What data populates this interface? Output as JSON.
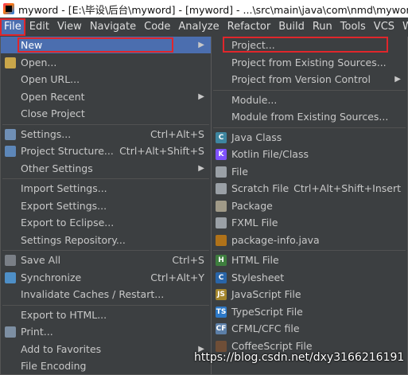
{
  "window": {
    "title": "myword - [E:\\毕设\\后台\\myword] - [myword] - ...\\src\\main\\java\\com\\nmd\\myword\\controller"
  },
  "menubar": [
    {
      "label": "File",
      "active": true
    },
    {
      "label": "Edit"
    },
    {
      "label": "View"
    },
    {
      "label": "Navigate"
    },
    {
      "label": "Code"
    },
    {
      "label": "Analyze"
    },
    {
      "label": "Refactor"
    },
    {
      "label": "Build"
    },
    {
      "label": "Run"
    },
    {
      "label": "Tools"
    },
    {
      "label": "VCS"
    },
    {
      "label": "Window"
    }
  ],
  "file_menu": [
    {
      "label": "New",
      "arrow": true,
      "selected": true
    },
    {
      "label": "Open...",
      "icon": "folder-icon"
    },
    {
      "label": "Open URL..."
    },
    {
      "label": "Open Recent",
      "arrow": true
    },
    {
      "label": "Close Project"
    },
    {
      "sep": true
    },
    {
      "label": "Settings...",
      "icon": "wrench-icon",
      "shortcut": "Ctrl+Alt+S"
    },
    {
      "label": "Project Structure...",
      "icon": "project-structure-icon",
      "shortcut": "Ctrl+Alt+Shift+S"
    },
    {
      "label": "Other Settings",
      "arrow": true
    },
    {
      "sep": true
    },
    {
      "label": "Import Settings..."
    },
    {
      "label": "Export Settings..."
    },
    {
      "label": "Export to Eclipse..."
    },
    {
      "label": "Settings Repository..."
    },
    {
      "sep": true
    },
    {
      "label": "Save All",
      "icon": "save-icon",
      "shortcut": "Ctrl+S"
    },
    {
      "label": "Synchronize",
      "icon": "sync-icon",
      "shortcut": "Ctrl+Alt+Y"
    },
    {
      "label": "Invalidate Caches / Restart..."
    },
    {
      "sep": true
    },
    {
      "label": "Export to HTML..."
    },
    {
      "label": "Print...",
      "icon": "print-icon"
    },
    {
      "label": "Add to Favorites",
      "arrow": true
    },
    {
      "label": "File Encoding"
    }
  ],
  "new_submenu": [
    {
      "label": "Project..."
    },
    {
      "label": "Project from Existing Sources..."
    },
    {
      "label": "Project from Version Control",
      "arrow": true
    },
    {
      "sep": true
    },
    {
      "label": "Module..."
    },
    {
      "label": "Module from Existing Sources..."
    },
    {
      "sep": true
    },
    {
      "label": "Java Class",
      "icon": "java-class-icon"
    },
    {
      "label": "Kotlin File/Class",
      "icon": "kotlin-icon"
    },
    {
      "label": "File",
      "icon": "file-icon"
    },
    {
      "label": "Scratch File",
      "icon": "scratch-file-icon",
      "shortcut": "Ctrl+Alt+Shift+Insert"
    },
    {
      "label": "Package",
      "icon": "package-icon"
    },
    {
      "label": "FXML File",
      "icon": "fxml-icon"
    },
    {
      "label": "package-info.java",
      "icon": "package-info-icon"
    },
    {
      "sep": true
    },
    {
      "label": "HTML File",
      "icon": "html-icon"
    },
    {
      "label": "Stylesheet",
      "icon": "css-icon"
    },
    {
      "label": "JavaScript File",
      "icon": "js-icon"
    },
    {
      "label": "TypeScript File",
      "icon": "ts-icon"
    },
    {
      "label": "CFML/CFC file",
      "icon": "cfml-icon"
    },
    {
      "label": "CoffeeScript File",
      "icon": "coffeescript-icon"
    }
  ],
  "watermark": "https://blog.csdn.net/dxy3166216191"
}
